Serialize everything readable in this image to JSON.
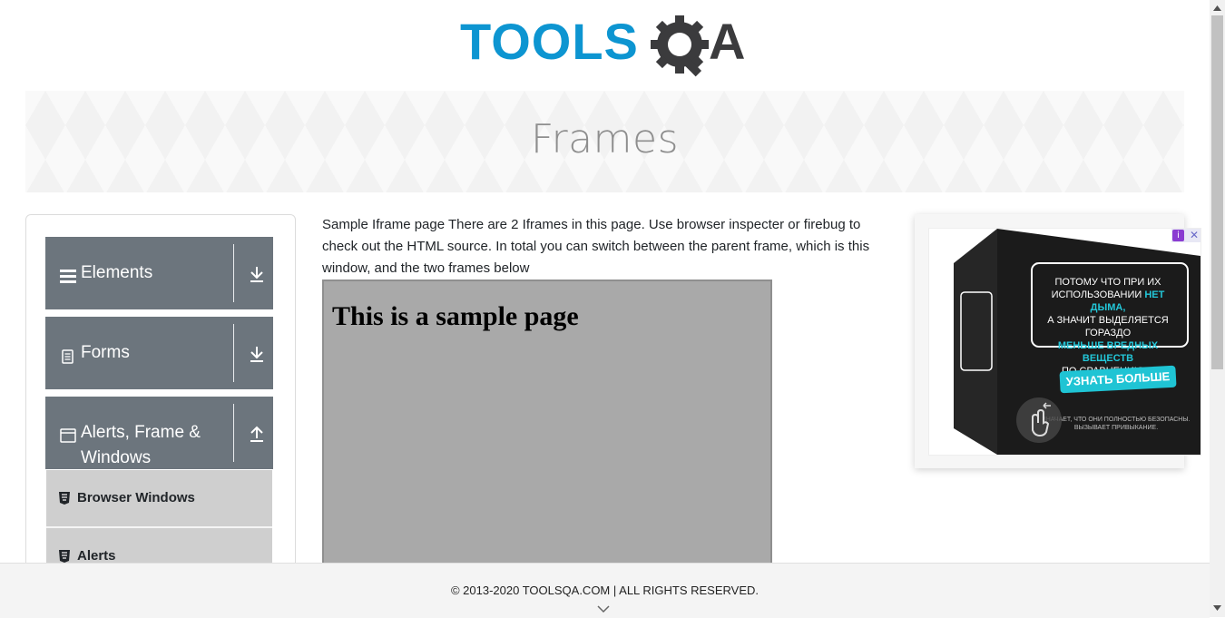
{
  "logo": {
    "text_part1": "TOOLS",
    "text_part2": "A",
    "primary_color": "#0d95d1",
    "secondary_color": "#3b3b3d"
  },
  "banner": {
    "title": "Frames"
  },
  "sidebar": {
    "groups": [
      {
        "label": "Elements",
        "icon": "hamburger-icon",
        "arrow": "download-arrow-icon"
      },
      {
        "label": "Forms",
        "icon": "document-icon",
        "arrow": "download-arrow-icon"
      },
      {
        "label": "Alerts, Frame & Windows",
        "icon": "browser-window-icon",
        "arrow": "upload-arrow-icon"
      }
    ],
    "items": [
      {
        "label": "Browser Windows",
        "icon": "html5-icon"
      },
      {
        "label": "Alerts",
        "icon": "html5-icon"
      }
    ]
  },
  "main": {
    "description": "Sample Iframe page There are 2 Iframes in this page. Use browser inspecter or firebug to check out the HTML source. In total you can switch between the parent frame, which is this window, and the two frames below",
    "frame_heading": "This is a sample page"
  },
  "ad": {
    "line1": "ПОТОМУ ЧТО ПРИ ИХ",
    "line2a": "ИСПОЛЬЗОВАНИИ ",
    "line2b": "НЕТ ДЫМА,",
    "line3": "А ЗНАЧИТ ВЫДЕЛЯЕТСЯ ГОРАЗДО",
    "line4": "МЕНЬШЕ ВРЕДНЫХ ВЕЩЕСТВ",
    "line5": "ПО СРАВНЕНИЮ С СИГАРЕТАМИ.",
    "cta": "УЗНАТЬ БОЛЬШЕ",
    "disclaimer": "ЗНАЧАЕТ, ЧТО ОНИ ПОЛНОСТЬЮ БЕЗОПАСНЫ. ВЫЗЫВАЕТ ПРИВЫКАНИЕ.",
    "accent_color": "#1fc4d4"
  },
  "footer": {
    "text": "© 2013-2020 TOOLSQA.COM | ALL RIGHTS RESERVED."
  },
  "colors": {
    "menu_header_bg": "#6c757d",
    "menu_item_bg": "#cfcfcf",
    "frame_bg": "#a9a9a9"
  }
}
